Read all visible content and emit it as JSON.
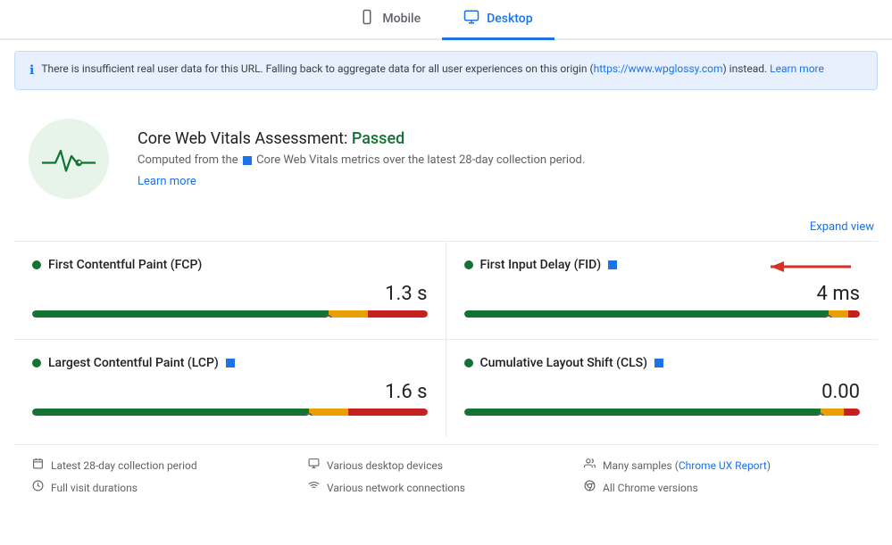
{
  "tabs": [
    {
      "id": "mobile",
      "label": "Mobile",
      "active": false,
      "icon": "📱"
    },
    {
      "id": "desktop",
      "label": "Desktop",
      "active": true,
      "icon": "🖥"
    }
  ],
  "banner": {
    "text": "There is insufficient real user data for this URL. Falling back to aggregate data for all user experiences on this origin (",
    "link_text": "https://www.wpglossy.com",
    "link_url": "https://www.wpglossy.com",
    "suffix": ") instead. Learn more",
    "learn_more_text": "Learn more",
    "learn_more_url": "#"
  },
  "cwv": {
    "title": "Core Web Vitals Assessment:",
    "status": "Passed",
    "desc_prefix": "Computed from the",
    "desc_main": "Core Web Vitals metrics over the latest 28-day collection period.",
    "learn_more_text": "Learn more",
    "learn_more_url": "#"
  },
  "expand_view_label": "Expand view",
  "metrics": [
    {
      "id": "fcp",
      "name": "First Contentful Paint (FCP)",
      "has_blue_square": false,
      "has_arrow": false,
      "value": "1.3 s",
      "progress": {
        "green": 75,
        "orange": 10,
        "red": 15,
        "marker": 75
      }
    },
    {
      "id": "fid",
      "name": "First Input Delay (FID)",
      "has_blue_square": true,
      "has_arrow": true,
      "value": "4 ms",
      "progress": {
        "green": 92,
        "orange": 5,
        "red": 3,
        "marker": 92
      }
    },
    {
      "id": "lcp",
      "name": "Largest Contentful Paint (LCP)",
      "has_blue_square": true,
      "has_arrow": false,
      "value": "1.6 s",
      "progress": {
        "green": 70,
        "orange": 10,
        "red": 20,
        "marker": 70
      }
    },
    {
      "id": "cls",
      "name": "Cumulative Layout Shift (CLS)",
      "has_blue_square": true,
      "has_arrow": false,
      "value": "0.00",
      "progress": {
        "green": 90,
        "orange": 6,
        "red": 4,
        "marker": 90
      }
    }
  ],
  "footer": {
    "items": [
      {
        "icon": "calendar",
        "text": "Latest 28-day collection period"
      },
      {
        "icon": "monitor",
        "text": "Various desktop devices"
      },
      {
        "icon": "people",
        "text": "Many samples (",
        "link_text": "Chrome UX Report",
        "link_url": "#",
        "suffix": ")"
      },
      {
        "icon": "clock",
        "text": "Full visit durations"
      },
      {
        "icon": "wifi",
        "text": "Various network connections"
      },
      {
        "icon": "chrome",
        "text": "All Chrome versions"
      }
    ]
  }
}
